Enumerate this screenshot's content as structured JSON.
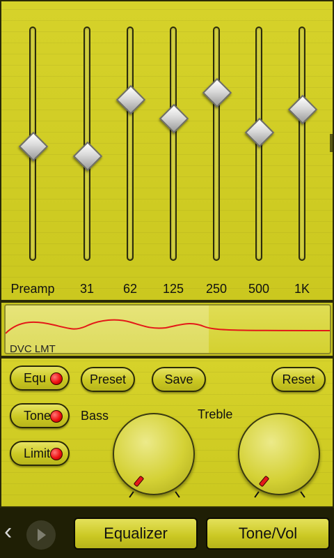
{
  "equalizer": {
    "bands": [
      {
        "label": "Preamp",
        "level": 0.49
      },
      {
        "label": "31",
        "level": 0.45
      },
      {
        "label": "62",
        "level": 0.69
      },
      {
        "label": "125",
        "level": 0.61
      },
      {
        "label": "250",
        "level": 0.72
      },
      {
        "label": "500",
        "level": 0.55
      },
      {
        "label": "1K",
        "level": 0.65
      }
    ]
  },
  "curve": {
    "label": "DVC LMT",
    "line_color": "#e31818"
  },
  "controls": {
    "equ_label": "Equ",
    "tone_label": "Tone",
    "limit_label": "Limit",
    "preset_label": "Preset",
    "save_label": "Save",
    "reset_label": "Reset",
    "bass_label": "Bass",
    "treble_label": "Treble"
  },
  "tabs": {
    "equalizer_label": "Equalizer",
    "tonevol_label": "Tone/Vol"
  },
  "icons": {
    "back": "‹",
    "play": "play-icon"
  },
  "colors": {
    "accent": "#c9c61e",
    "led": "#ee1111"
  }
}
